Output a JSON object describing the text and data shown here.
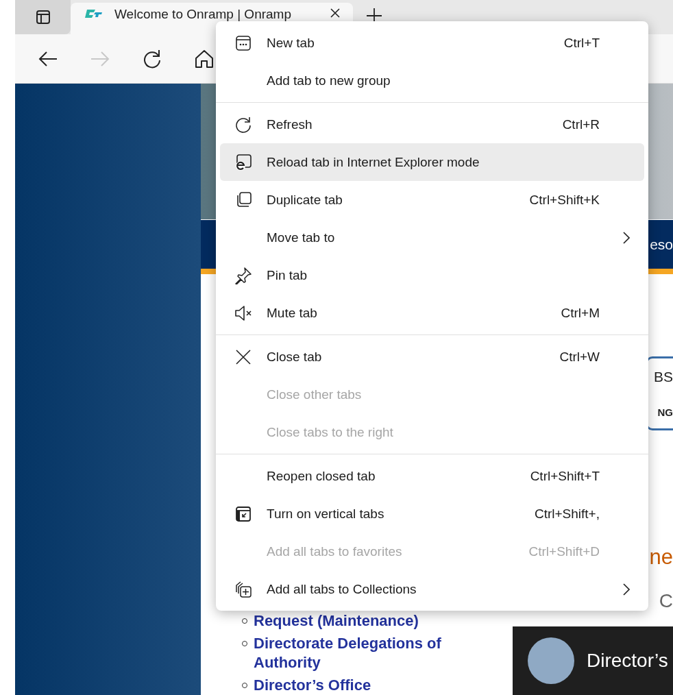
{
  "browser": {
    "tab": {
      "title": "Welcome to Onramp | Onramp",
      "selected": true
    }
  },
  "page": {
    "banner_text": "eso",
    "badge": [
      "BS",
      "NG"
    ],
    "heading_fragment": "ne",
    "subheading": "C",
    "links": [
      "Request (Maintenance)",
      "Directorate Delegations of Authority",
      "Director’s Office"
    ],
    "video_title": "Director’s"
  },
  "context_menu": {
    "groups": [
      {
        "items": [
          {
            "label": "New tab",
            "shortcut": "Ctrl+T",
            "disabled": false,
            "selected": false,
            "submenu": false
          },
          {
            "label": "Add tab to new group",
            "disabled": false,
            "selected": false,
            "submenu": false
          }
        ]
      },
      {
        "items": [
          {
            "label": "Refresh",
            "shortcut": "Ctrl+R",
            "disabled": false,
            "selected": false,
            "submenu": false
          },
          {
            "label": "Reload tab in Internet Explorer mode",
            "disabled": false,
            "selected": true,
            "submenu": false
          },
          {
            "label": "Duplicate tab",
            "shortcut": "Ctrl+Shift+K",
            "disabled": false,
            "selected": false,
            "submenu": false
          },
          {
            "label": "Move tab to",
            "disabled": false,
            "selected": false,
            "submenu": true
          },
          {
            "label": "Pin tab",
            "disabled": false,
            "selected": false,
            "submenu": false
          },
          {
            "label": "Mute tab",
            "shortcut": "Ctrl+M",
            "disabled": false,
            "selected": false,
            "submenu": false
          }
        ]
      },
      {
        "items": [
          {
            "label": "Close tab",
            "shortcut": "Ctrl+W",
            "disabled": false,
            "selected": false,
            "submenu": false
          },
          {
            "label": "Close other tabs",
            "disabled": true,
            "selected": false,
            "submenu": false
          },
          {
            "label": "Close tabs to the right",
            "disabled": true,
            "selected": false,
            "submenu": false
          }
        ]
      },
      {
        "items": [
          {
            "label": "Reopen closed tab",
            "shortcut": "Ctrl+Shift+T",
            "disabled": false,
            "selected": false,
            "submenu": false
          },
          {
            "label": "Turn on vertical tabs",
            "shortcut": "Ctrl+Shift+,",
            "disabled": false,
            "selected": false,
            "submenu": false
          },
          {
            "label": "Add all tabs to favorites",
            "shortcut": "Ctrl+Shift+D",
            "disabled": true,
            "selected": false,
            "submenu": false
          },
          {
            "label": "Add all tabs to Collections",
            "disabled": false,
            "selected": false,
            "submenu": true
          }
        ]
      }
    ]
  }
}
